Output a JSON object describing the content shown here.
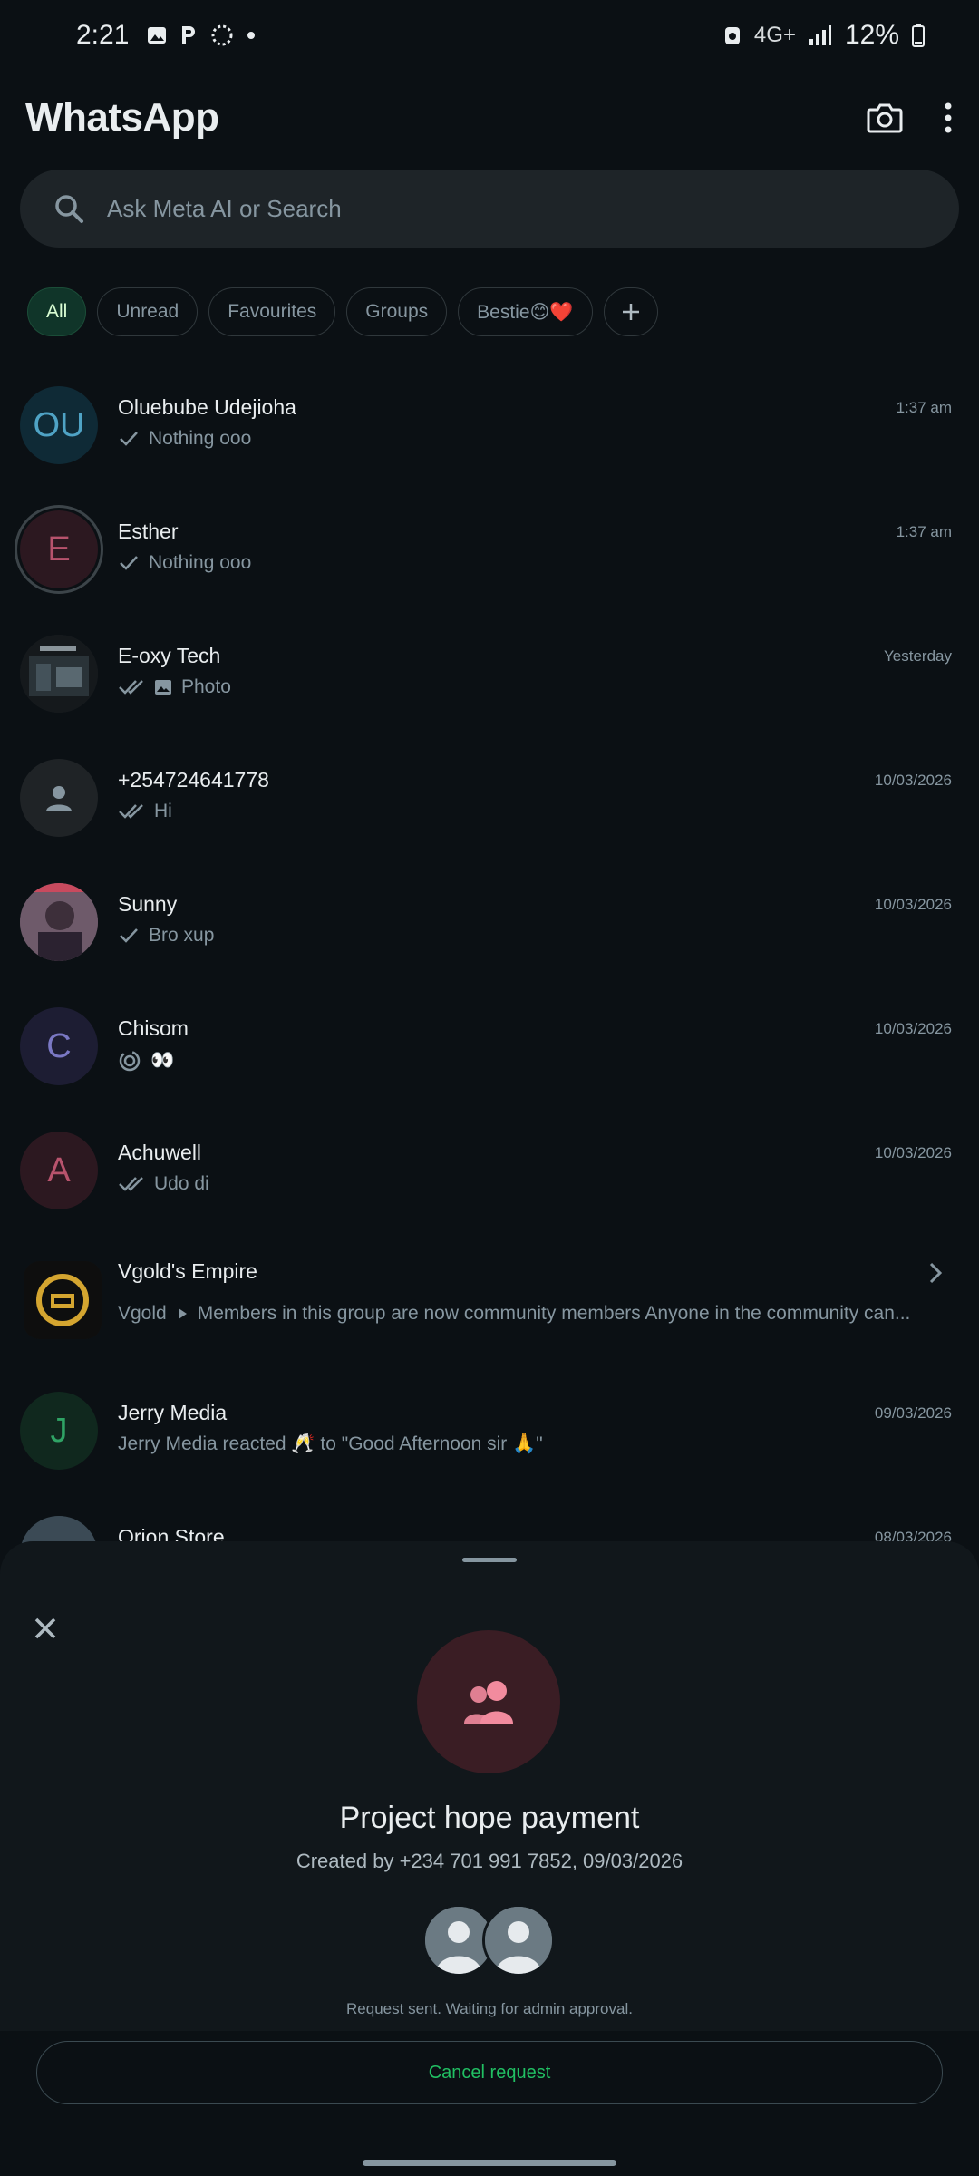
{
  "status_bar": {
    "time": "2:21",
    "left_icons": [
      "image-icon",
      "p-letter-icon",
      "loading-icon",
      "dot-icon"
    ],
    "network": "4G+",
    "battery": "12%"
  },
  "header": {
    "title": "WhatsApp",
    "camera_icon": "camera-icon",
    "menu_icon": "more-vert-icon"
  },
  "search": {
    "placeholder": "Ask Meta AI or Search"
  },
  "filters": {
    "chips": [
      "All",
      "Unread",
      "Favourites",
      "Groups",
      "Bestie😊❤️"
    ],
    "active": "All"
  },
  "chats": [
    {
      "name": "Oluebube Udejioha",
      "preview": "Nothing ooo",
      "time": "1:37 am",
      "initials": "OU",
      "avatar_bg": "#0f2a36",
      "avatar_fg": "#4fa3c5",
      "tick": "single"
    },
    {
      "name": "Esther",
      "preview": "Nothing ooo",
      "time": "1:37 am",
      "initials": "E",
      "avatar_bg": "#2c1820",
      "avatar_fg": "#b8536d",
      "tick": "single"
    },
    {
      "name": "E-oxy Tech",
      "preview": "Photo",
      "time": "Yesterday",
      "initials": "",
      "avatar_bg": "#1c2327",
      "avatar_fg": "#ffffff",
      "tick": "double"
    },
    {
      "name": "+254724641778",
      "preview": "Hi",
      "time": "10/03/2026",
      "initials": "",
      "avatar_bg": "#1f2326",
      "avatar_fg": "#8696a0",
      "tick": "double"
    },
    {
      "name": "Sunny",
      "preview": "Bro xup",
      "time": "10/03/2026",
      "initials": "",
      "avatar_bg": "#5a4b58",
      "avatar_fg": "#ffffff",
      "tick": "single"
    },
    {
      "name": "Chisom",
      "preview": "👀",
      "time": "10/03/2026",
      "initials": "C",
      "avatar_bg": "#1d1d33",
      "avatar_fg": "#7a78c4",
      "tick": "none"
    },
    {
      "name": "Achuwell",
      "preview": "Udo di",
      "time": "10/03/2026",
      "initials": "A",
      "avatar_bg": "#2c1820",
      "avatar_fg": "#b8536d",
      "tick": "double"
    },
    {
      "name": "Vgold's Empire",
      "preview": "Members in this group are now community members Anyone in the community can...",
      "preview_prefix": "Vgold",
      "time": "",
      "initials": "",
      "avatar_bg": "#1a1a1a",
      "avatar_fg": "#d4a530",
      "tick": "none"
    },
    {
      "name": "Jerry Media",
      "preview": "Jerry Media reacted 🥂 to \"Good Afternoon sir 🙏\"",
      "time": "09/03/2026",
      "initials": "J",
      "avatar_bg": "#10281e",
      "avatar_fg": "#2fa365",
      "tick": "none"
    },
    {
      "name": "Orion Store",
      "preview": "",
      "time": "08/03/2026",
      "initials": "",
      "avatar_bg": "#2d3a44",
      "avatar_fg": "#ffffff",
      "tick": "none"
    }
  ],
  "sheet": {
    "group_name": "Project hope payment",
    "created": "Created by +234 701 991 7852, 09/03/2026",
    "status": "Request sent. Waiting for admin approval.",
    "cancel_label": "Cancel request",
    "accent": "#21c063",
    "group_icon_color": "#f28b9e"
  }
}
